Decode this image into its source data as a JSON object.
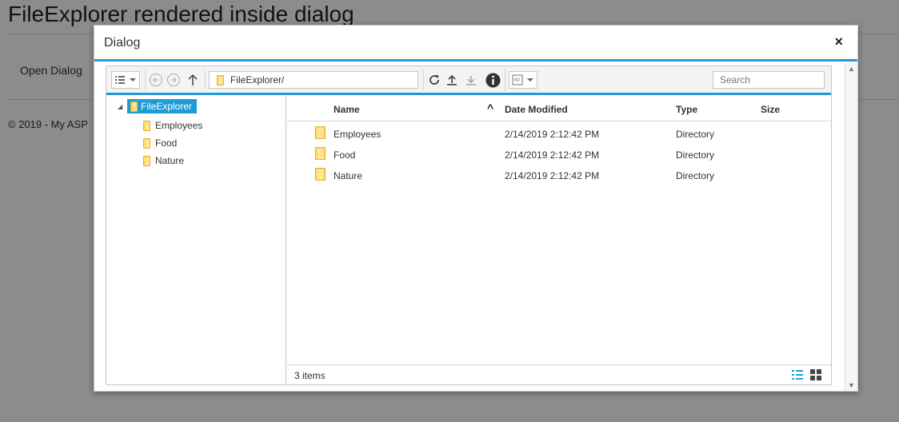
{
  "page": {
    "title": "FileExplorer rendered inside dialog",
    "open_dialog_label": "Open Dialog",
    "footer": "© 2019 - My ASP"
  },
  "dialog": {
    "title": "Dialog",
    "close_glyph": "×"
  },
  "toolbar": {
    "breadcrumb": "FileExplorer/",
    "search_placeholder": "Search",
    "icons": [
      "view-options-icon",
      "back-icon",
      "forward-icon",
      "up-icon",
      "refresh-icon",
      "upload-icon",
      "download-icon",
      "info-icon",
      "sort-icon"
    ]
  },
  "tree": {
    "root": "FileExplorer",
    "children": [
      "Employees",
      "Food",
      "Nature"
    ]
  },
  "grid": {
    "columns": {
      "name": "Name",
      "date": "Date Modified",
      "type": "Type",
      "size": "Size"
    },
    "rows": [
      {
        "name": "Employees",
        "date": "2/14/2019 2:12:42 PM",
        "type": "Directory",
        "size": ""
      },
      {
        "name": "Food",
        "date": "2/14/2019 2:12:42 PM",
        "type": "Directory",
        "size": ""
      },
      {
        "name": "Nature",
        "date": "2/14/2019 2:12:42 PM",
        "type": "Directory",
        "size": ""
      }
    ],
    "footer_count": "3 items"
  },
  "colors": {
    "accent": "#1e9cd7",
    "folder": "#ffd966"
  }
}
